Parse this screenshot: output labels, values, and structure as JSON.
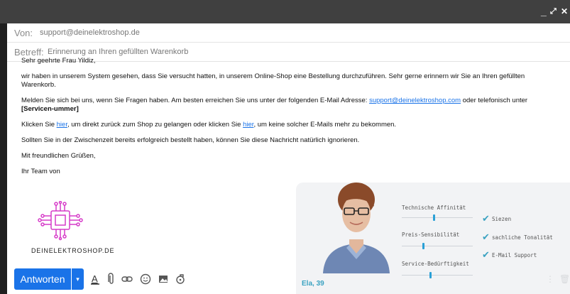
{
  "window": {
    "minimize": "_",
    "maximize": "⤢",
    "close": "✕"
  },
  "header": {
    "from_label": "Von:",
    "from_value": "support@deinelektroshop.de",
    "subject_label": "Betreff:",
    "subject_value": "Erinnerung an Ihren gefüllten Warenkorb"
  },
  "email": {
    "greeting": "Sehr geehrte Frau Yildiz,",
    "p1": "wir haben in unserem System gesehen, dass Sie versucht hatten, in unserem Online-Shop eine Bestellung durchzuführen. Sehr gerne erinnern wir Sie an Ihren gefüllten Warenkorb.",
    "p2_a": "Melden Sie sich bei uns, wenn Sie Fragen haben. Am besten erreichen Sie uns unter der folgenden E-Mail Adresse: ",
    "p2_link": "support@deinelektroshop.com",
    "p2_b": " oder telefonisch unter ",
    "p2_bold": "[Servicen-ummer]",
    "p3_a": "Klicken Sie ",
    "p3_link1": "hier",
    "p3_b": ", um direkt zurück zum Shop zu gelangen oder klicken Sie ",
    "p3_link2": "hier",
    "p3_c": ", um keine solcher E-Mails mehr zu bekommen.",
    "p4": "Sollten Sie in der Zwischenzeit bereits erfolgreich bestellt haben, können Sie diese Nachricht natürlich ignorieren.",
    "closing": "Mit freundlichen Grüßen,",
    "team": "Ihr Team von",
    "brand": "DEINELEKTROSHOP.DE"
  },
  "toolbar": {
    "reply_label": "Antworten",
    "reply_dropdown": "▾",
    "icons": [
      "format-text-icon",
      "attach-icon",
      "link-icon",
      "emoji-icon",
      "image-icon",
      "lock-icon"
    ]
  },
  "persona": {
    "name": "Ela, 39",
    "sliders": [
      {
        "label": "Technische Affinität",
        "level": 0.45
      },
      {
        "label": "Preis-Sensibilität",
        "level": 0.3
      },
      {
        "label": "Service-Bedürftigkeit",
        "level": 0.4
      }
    ],
    "checks": [
      "Siezen",
      "sachliche Tonalität",
      "E-Mail Support"
    ]
  },
  "colors": {
    "accent": "#1a73e8",
    "persona_accent": "#3aa2c1",
    "logo": "#d63bc8"
  }
}
